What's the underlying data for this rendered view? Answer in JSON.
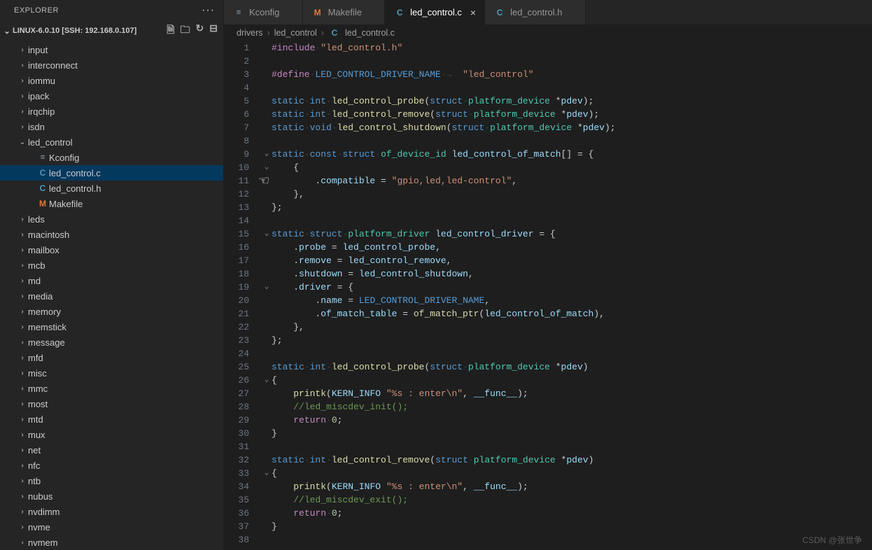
{
  "explorer": {
    "title": "EXPLORER",
    "ellipsis": "···",
    "workspace": "LINUX-6.0.10 [SSH: 192.168.0.107]",
    "action_icons": [
      "new-file-icon",
      "new-folder-icon",
      "refresh-icon",
      "collapse-all-icon"
    ]
  },
  "tree": [
    {
      "name": "input",
      "type": "folder",
      "depth": 2,
      "expanded": false
    },
    {
      "name": "interconnect",
      "type": "folder",
      "depth": 2,
      "expanded": false
    },
    {
      "name": "iommu",
      "type": "folder",
      "depth": 2,
      "expanded": false
    },
    {
      "name": "ipack",
      "type": "folder",
      "depth": 2,
      "expanded": false
    },
    {
      "name": "irqchip",
      "type": "folder",
      "depth": 2,
      "expanded": false
    },
    {
      "name": "isdn",
      "type": "folder",
      "depth": 2,
      "expanded": false
    },
    {
      "name": "led_control",
      "type": "folder",
      "depth": 2,
      "expanded": true
    },
    {
      "name": "Kconfig",
      "type": "file",
      "icon": "k",
      "depth": 3
    },
    {
      "name": "led_control.c",
      "type": "file",
      "icon": "c",
      "depth": 3,
      "selected": true
    },
    {
      "name": "led_control.h",
      "type": "file",
      "icon": "c",
      "depth": 3
    },
    {
      "name": "Makefile",
      "type": "file",
      "icon": "m",
      "depth": 3
    },
    {
      "name": "leds",
      "type": "folder",
      "depth": 2,
      "expanded": false
    },
    {
      "name": "macintosh",
      "type": "folder",
      "depth": 2,
      "expanded": false
    },
    {
      "name": "mailbox",
      "type": "folder",
      "depth": 2,
      "expanded": false
    },
    {
      "name": "mcb",
      "type": "folder",
      "depth": 2,
      "expanded": false
    },
    {
      "name": "md",
      "type": "folder",
      "depth": 2,
      "expanded": false
    },
    {
      "name": "media",
      "type": "folder",
      "depth": 2,
      "expanded": false
    },
    {
      "name": "memory",
      "type": "folder",
      "depth": 2,
      "expanded": false
    },
    {
      "name": "memstick",
      "type": "folder",
      "depth": 2,
      "expanded": false
    },
    {
      "name": "message",
      "type": "folder",
      "depth": 2,
      "expanded": false
    },
    {
      "name": "mfd",
      "type": "folder",
      "depth": 2,
      "expanded": false
    },
    {
      "name": "misc",
      "type": "folder",
      "depth": 2,
      "expanded": false
    },
    {
      "name": "mmc",
      "type": "folder",
      "depth": 2,
      "expanded": false
    },
    {
      "name": "most",
      "type": "folder",
      "depth": 2,
      "expanded": false
    },
    {
      "name": "mtd",
      "type": "folder",
      "depth": 2,
      "expanded": false
    },
    {
      "name": "mux",
      "type": "folder",
      "depth": 2,
      "expanded": false
    },
    {
      "name": "net",
      "type": "folder",
      "depth": 2,
      "expanded": false
    },
    {
      "name": "nfc",
      "type": "folder",
      "depth": 2,
      "expanded": false
    },
    {
      "name": "ntb",
      "type": "folder",
      "depth": 2,
      "expanded": false
    },
    {
      "name": "nubus",
      "type": "folder",
      "depth": 2,
      "expanded": false
    },
    {
      "name": "nvdimm",
      "type": "folder",
      "depth": 2,
      "expanded": false
    },
    {
      "name": "nvme",
      "type": "folder",
      "depth": 2,
      "expanded": false
    },
    {
      "name": "nvmem",
      "type": "folder",
      "depth": 2,
      "expanded": false
    }
  ],
  "tabs": [
    {
      "icon": "k",
      "label": "Kconfig",
      "active": false
    },
    {
      "icon": "m",
      "label": "Makefile",
      "active": false
    },
    {
      "icon": "c",
      "label": "led_control.c",
      "active": true
    },
    {
      "icon": "c",
      "label": "led_control.h",
      "active": false
    }
  ],
  "breadcrumbs": [
    "drivers",
    "led_control",
    "led_control.c"
  ],
  "breadcrumb_icon": "C",
  "code": [
    {
      "n": 1,
      "fold": "",
      "html": "<span class='dir'>#include</span><span class='white-dot'>·</span><span class='str'>\"led_control.h\"</span>"
    },
    {
      "n": 2,
      "fold": "",
      "html": ""
    },
    {
      "n": 3,
      "fold": "",
      "html": "<span class='dir'>#define</span><span class='white-dot'>·</span><span class='mac'>LED_CONTROL_DRIVER_NAME</span><span class='white-dot'>·→  </span><span class='str'>\"led_control\"</span>"
    },
    {
      "n": 4,
      "fold": "",
      "html": ""
    },
    {
      "n": 5,
      "fold": "",
      "html": "<span class='kw'>static</span><span class='white-dot'>·</span><span class='kw'>int</span><span class='white-dot'>·</span><span class='fn'>led_control_probe</span>(<span class='kw'>struct</span><span class='white-dot'>·</span><span class='type'>platform_device</span> *<span class='ident'>pdev</span>);"
    },
    {
      "n": 6,
      "fold": "",
      "html": "<span class='kw'>static</span><span class='white-dot'>·</span><span class='kw'>int</span><span class='white-dot'>·</span><span class='fn'>led_control_remove</span>(<span class='kw'>struct</span><span class='white-dot'>·</span><span class='type'>platform_device</span> *<span class='ident'>pdev</span>);"
    },
    {
      "n": 7,
      "fold": "",
      "html": "<span class='kw'>static</span><span class='white-dot'>·</span><span class='kw'>void</span><span class='white-dot'>·</span><span class='fn'>led_control_shutdown</span>(<span class='kw'>struct</span><span class='white-dot'>·</span><span class='type'>platform_device</span> *<span class='ident'>pdev</span>);"
    },
    {
      "n": 8,
      "fold": "",
      "html": ""
    },
    {
      "n": 9,
      "fold": "⌄",
      "html": "<span class='kw'>static</span><span class='white-dot'>·</span><span class='kw'>const</span><span class='white-dot'>·</span><span class='kw'>struct</span><span class='white-dot'>·</span><span class='type'>of_device_id</span> <span class='ident'>led_control_of_match</span>[] = {"
    },
    {
      "n": 10,
      "fold": "⌄",
      "html": "    {"
    },
    {
      "n": 11,
      "fold": "",
      "html": "        .<span class='ident'>compatible</span> = <span class='str'>\"gpio,led,led-control\"</span>,"
    },
    {
      "n": 12,
      "fold": "",
      "html": "    },"
    },
    {
      "n": 13,
      "fold": "",
      "html": "};"
    },
    {
      "n": 14,
      "fold": "",
      "html": ""
    },
    {
      "n": 15,
      "fold": "⌄",
      "html": "<span class='kw'>static</span><span class='white-dot'>·</span><span class='kw'>struct</span><span class='white-dot'>·</span><span class='type'>platform_driver</span> <span class='ident'>led_control_driver</span> = {"
    },
    {
      "n": 16,
      "fold": "",
      "html": "    .<span class='ident'>probe</span> = <span class='ident'>led_control_probe</span>,"
    },
    {
      "n": 17,
      "fold": "",
      "html": "    .<span class='ident'>remove</span> = <span class='ident'>led_control_remove</span>,"
    },
    {
      "n": 18,
      "fold": "",
      "html": "    .<span class='ident'>shutdown</span> = <span class='ident'>led_control_shutdown</span>,"
    },
    {
      "n": 19,
      "fold": "⌄",
      "html": "    .<span class='ident'>driver</span> = {"
    },
    {
      "n": 20,
      "fold": "",
      "html": "        .<span class='ident'>name</span> = <span class='mac'>LED_CONTROL_DRIVER_NAME</span>,"
    },
    {
      "n": 21,
      "fold": "",
      "html": "        .<span class='ident'>of_match_table</span> = <span class='fn'>of_match_ptr</span>(<span class='ident'>led_control_of_match</span>),"
    },
    {
      "n": 22,
      "fold": "",
      "html": "    },"
    },
    {
      "n": 23,
      "fold": "",
      "html": "};"
    },
    {
      "n": 24,
      "fold": "",
      "html": ""
    },
    {
      "n": 25,
      "fold": "",
      "html": "<span class='kw'>static</span><span class='white-dot'>·</span><span class='kw'>int</span><span class='white-dot'>·</span><span class='fn'>led_control_probe</span>(<span class='kw'>struct</span><span class='white-dot'>·</span><span class='type'>platform_device</span> *<span class='ident'>pdev</span>)"
    },
    {
      "n": 26,
      "fold": "⌄",
      "html": "{"
    },
    {
      "n": 27,
      "fold": "",
      "html": "    <span class='fn'>printk</span>(<span class='ident'>KERN_INFO</span> <span class='str'>\"%s : enter\\n\"</span>, <span class='ident'>__func__</span>);"
    },
    {
      "n": 28,
      "fold": "",
      "html": "    <span class='com'>//led_miscdev_init();</span>"
    },
    {
      "n": 29,
      "fold": "",
      "html": "    <span class='dir'>return</span><span class='white-dot'>·</span><span class='num2'>0</span>;"
    },
    {
      "n": 30,
      "fold": "",
      "html": "}"
    },
    {
      "n": 31,
      "fold": "",
      "html": ""
    },
    {
      "n": 32,
      "fold": "",
      "html": "<span class='kw'>static</span><span class='white-dot'>·</span><span class='kw'>int</span><span class='white-dot'>·</span><span class='fn'>led_control_remove</span>(<span class='kw'>struct</span><span class='white-dot'>·</span><span class='type'>platform_device</span> *<span class='ident'>pdev</span>)"
    },
    {
      "n": 33,
      "fold": "⌄",
      "html": "{"
    },
    {
      "n": 34,
      "fold": "",
      "html": "    <span class='fn'>printk</span>(<span class='ident'>KERN_INFO</span> <span class='str'>\"%s : enter\\n\"</span>, <span class='ident'>__func__</span>);"
    },
    {
      "n": 35,
      "fold": "",
      "html": "    <span class='com'>//led_miscdev_exit();</span>"
    },
    {
      "n": 36,
      "fold": "",
      "html": "    <span class='dir'>return</span><span class='white-dot'>·</span><span class='num2'>0</span>;"
    },
    {
      "n": 37,
      "fold": "",
      "html": "}"
    },
    {
      "n": 38,
      "fold": "",
      "html": ""
    }
  ],
  "watermark": "CSDN @张世争"
}
